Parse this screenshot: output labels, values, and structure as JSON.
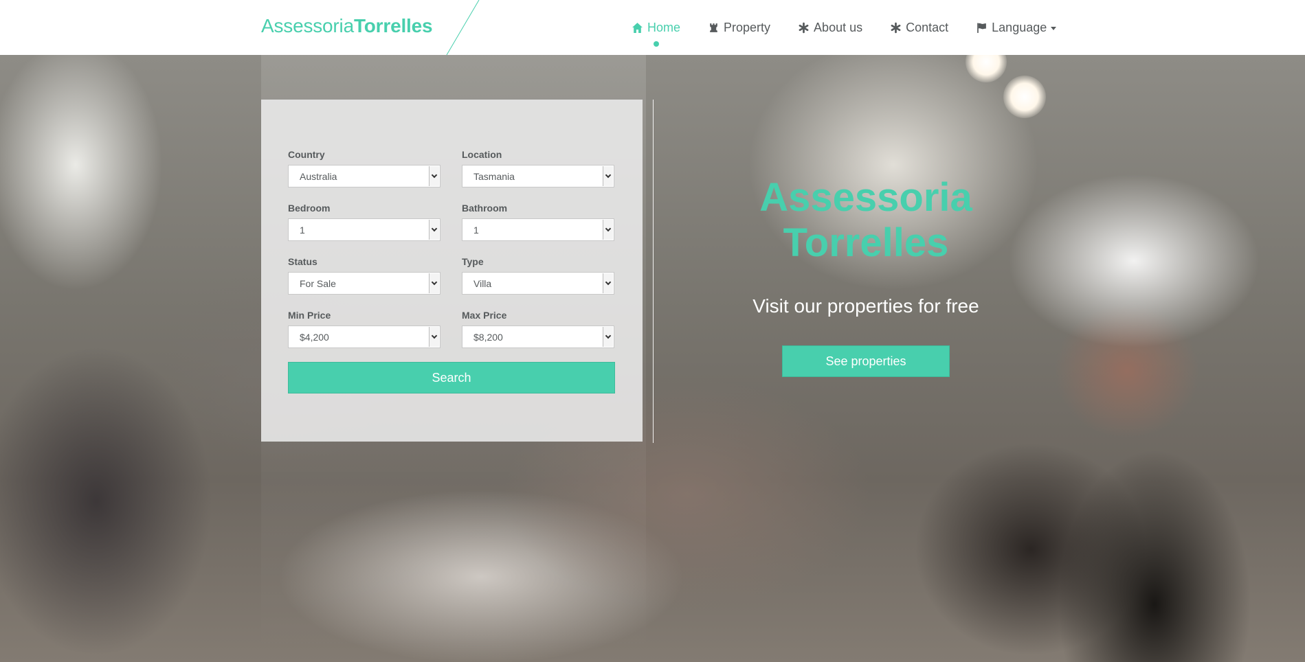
{
  "brand": {
    "logo_light": "Assessoria",
    "logo_bold": "Torrelles",
    "accent_color": "#48cfad"
  },
  "nav": {
    "items": [
      {
        "label": "Home",
        "icon": "home-icon",
        "active": true
      },
      {
        "label": "Property",
        "icon": "chess-rook-icon",
        "active": false
      },
      {
        "label": "About us",
        "icon": "asterisk-icon",
        "active": false
      },
      {
        "label": "Contact",
        "icon": "asterisk-icon",
        "active": false
      },
      {
        "label": "Language",
        "icon": "flag-icon",
        "active": false,
        "dropdown": true
      }
    ]
  },
  "search": {
    "fields": [
      {
        "label": "Country",
        "value": "Australia"
      },
      {
        "label": "Location",
        "value": "Tasmania"
      },
      {
        "label": "Bedroom",
        "value": "1"
      },
      {
        "label": "Bathroom",
        "value": "1"
      },
      {
        "label": "Status",
        "value": "For Sale"
      },
      {
        "label": "Type",
        "value": "Villa"
      },
      {
        "label": "Min Price",
        "value": "$4,200"
      },
      {
        "label": "Max Price",
        "value": "$8,200"
      }
    ],
    "button_label": "Search"
  },
  "hero": {
    "title_line1": "Assessoria",
    "title_line2": "Torrelles",
    "subtitle": "Visit our properties for free",
    "cta_label": "See properties"
  }
}
